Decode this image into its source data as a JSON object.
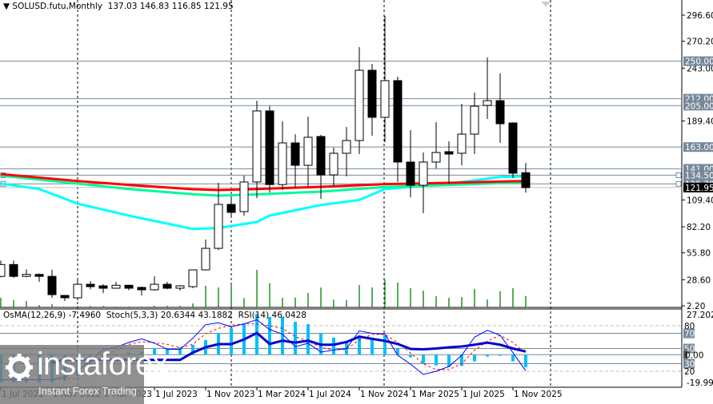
{
  "header": {
    "symbol": "SOLUSD.futu,Monthly",
    "ohlc": "137.03 146.83 116.85 121.95"
  },
  "indicator_header": {
    "osma": "OsMA(12,26,9) -7.4960",
    "stoch": "Stoch(5,3,3) 20.6344 43.1882",
    "rsi": "RSI(14) 46.0428"
  },
  "colors": {
    "level": "#778899",
    "volume": "#008000",
    "osma": "#00bfff",
    "ma_red": "#ff0000",
    "ma_green": "#00fa9a",
    "ma_cyan": "#00ffff",
    "stoch_main": "#0000ff",
    "stoch_signal": "#ff0000",
    "rsi": "#0000cd"
  },
  "price_axis": [
    "296.60",
    "270.20",
    "243.00",
    "189.40",
    "109.40",
    "82.20",
    "55.80",
    "28.60",
    "2.20"
  ],
  "levels": [
    "250.00",
    "212.00",
    "205.00",
    "163.00",
    "141.00",
    "134.50",
    "125.70"
  ],
  "current_price": "121.95",
  "indicator_axis": {
    "top": "27.2028",
    "bottom": "-19.9928",
    "levels": [
      "80",
      "70",
      "50",
      "30",
      "20"
    ],
    "zero": "0.00"
  },
  "time_axis": [
    "1 Jul 2022",
    "1 Nov 2022",
    "1 Mar 2023",
    "1 Jul 2023",
    "1 Nov 2023",
    "1 Mar 2024",
    "1 Jul 2024",
    "1 Nov 2024",
    "1 Mar 2025",
    "1 Jul 2025",
    "1 Nov 2025"
  ],
  "watermark": {
    "brand": "instaforex",
    "tagline": "Instant Forex Trading"
  },
  "candles": [
    [
      32,
      48,
      31,
      44
    ],
    [
      44,
      48,
      30.5,
      32
    ],
    [
      32,
      39,
      31,
      34
    ],
    [
      34,
      35,
      26.5,
      32
    ],
    [
      32,
      38.6,
      10.3,
      13.5
    ],
    [
      12.7,
      13,
      7,
      10.3
    ],
    [
      10.3,
      29.7,
      7.8,
      24
    ],
    [
      24,
      27.3,
      19,
      21.6
    ],
    [
      22.4,
      24,
      15,
      20
    ],
    [
      20,
      26.5,
      20,
      23
    ],
    [
      23,
      23.5,
      18,
      20
    ],
    [
      20.8,
      21.6,
      12.7,
      18.4
    ],
    [
      18.4,
      32.1,
      17.6,
      24
    ],
    [
      24,
      26.5,
      19,
      20
    ],
    [
      20,
      23.2,
      17.6,
      22.4
    ],
    [
      21.6,
      39,
      20,
      38.6
    ],
    [
      38.6,
      69.3,
      38,
      60.4
    ],
    [
      60.4,
      126.7,
      58.8,
      104.9
    ],
    [
      104.9,
      112,
      93,
      96.8
    ],
    [
      97.6,
      134,
      93.6,
      127.6
    ],
    [
      127.6,
      210,
      111.4,
      199.6
    ],
    [
      199.6,
      204.4,
      117,
      125
    ],
    [
      125,
      189,
      119.5,
      167.2
    ],
    [
      167.2,
      176,
      122,
      144.5
    ],
    [
      144.5,
      193.9,
      123.5,
      172.9
    ],
    [
      173.7,
      175.3,
      110.6,
      134.8
    ],
    [
      134.8,
      162.3,
      123.5,
      156.7
    ],
    [
      156.7,
      183.4,
      133.2,
      169.6
    ],
    [
      169.6,
      264.2,
      155.9,
      240.8
    ],
    [
      240.8,
      247.3,
      174.5,
      193.1
    ],
    [
      193.1,
      295.8,
      168,
      230.3
    ],
    [
      230.3,
      234.3,
      127.6,
      147.8
    ],
    [
      147.8,
      180.1,
      112.2,
      124.3
    ],
    [
      124.3,
      157.5,
      96,
      147.8
    ],
    [
      147.8,
      188.2,
      141.3,
      157.5
    ],
    [
      158.3,
      168.8,
      126,
      155.9
    ],
    [
      156.7,
      206.8,
      144.5,
      176.1
    ],
    [
      176.1,
      218.1,
      155.9,
      204.4
    ],
    [
      205.2,
      253.7,
      191.5,
      210
    ],
    [
      210,
      237.6,
      167.2,
      186.6
    ],
    [
      187.4,
      188,
      131.6,
      136.5
    ],
    [
      137.03,
      146.83,
      116.85,
      121.95
    ]
  ],
  "volume": [
    36,
    27,
    24,
    9,
    12,
    2,
    5,
    6,
    5,
    3,
    3,
    3,
    6,
    6,
    6,
    15,
    81,
    75,
    86,
    35,
    141,
    91,
    36,
    37,
    54,
    75,
    29,
    27,
    84,
    75,
    104,
    93,
    72,
    63,
    42,
    36,
    39,
    69,
    30,
    60,
    72,
    43
  ],
  "moving_averages": {
    "red": [
      [
        0,
        135.6
      ],
      [
        6,
        128.6
      ],
      [
        10,
        124.6
      ],
      [
        15,
        120.3
      ],
      [
        17,
        119.5
      ],
      [
        20,
        120.5
      ],
      [
        25,
        122.7
      ],
      [
        30,
        125.4
      ],
      [
        35,
        126.8
      ],
      [
        39,
        128.1
      ],
      [
        41,
        128.6
      ]
    ],
    "green": [
      [
        0,
        134
      ],
      [
        6,
        126
      ],
      [
        10,
        120.5
      ],
      [
        15,
        115.2
      ],
      [
        17,
        113.8
      ],
      [
        20,
        115
      ],
      [
        25,
        117.9
      ],
      [
        30,
        122.5
      ],
      [
        35,
        124.6
      ],
      [
        41,
        127.3
      ]
    ],
    "cyan": [
      [
        0,
        126
      ],
      [
        3,
        120.5
      ],
      [
        6,
        105.7
      ],
      [
        10,
        93.6
      ],
      [
        15,
        80
      ],
      [
        17,
        81
      ],
      [
        20,
        87.1
      ],
      [
        21,
        93.6
      ],
      [
        25,
        104.3
      ],
      [
        28,
        109.4
      ],
      [
        30,
        120.5
      ],
      [
        35,
        126
      ],
      [
        39,
        132.6
      ],
      [
        41,
        133.4
      ]
    ]
  },
  "osma": [
    -17,
    -17,
    -17,
    -17,
    -17,
    -16,
    -13,
    -8,
    -2.7,
    -0.8,
    1.3,
    2,
    3.9,
    3.6,
    4.5,
    6,
    8.9,
    13.1,
    16.2,
    18.8,
    24.9,
    23,
    23,
    20,
    18.6,
    12.9,
    10.4,
    7.8,
    11.7,
    9.7,
    11.7,
    3.6,
    -1.6,
    -5.2,
    -6.5,
    -7.4,
    -6.8,
    -4,
    -1.1,
    -0.6,
    -4,
    -7.5
  ],
  "stoch_main": [
    8.7,
    8.7,
    9,
    9,
    9,
    12.6,
    20,
    34,
    48.4,
    51.6,
    58,
    62.8,
    57,
    49,
    49,
    63.5,
    81.4,
    83.9,
    78.6,
    82.5,
    88,
    75,
    69,
    52.3,
    57,
    45.3,
    48,
    50,
    73.3,
    70,
    69,
    41,
    29.5,
    15.8,
    20,
    26.3,
    41,
    65,
    74,
    67.5,
    44.5,
    20.6
  ],
  "stoch_signal": [
    9,
    9,
    9,
    9,
    9,
    10,
    10,
    20.8,
    38.6,
    48.4,
    55.4,
    58.9,
    57.7,
    55.4,
    51.2,
    55.4,
    69.5,
    76.5,
    80.7,
    82.5,
    82.5,
    80,
    76.5,
    65.6,
    59.6,
    51.5,
    48,
    49,
    61.4,
    68.5,
    68.5,
    58,
    44,
    30,
    22.2,
    22.2,
    30,
    47.7,
    59.6,
    67.5,
    58,
    43.2
  ],
  "rsi": [
    null,
    null,
    null,
    null,
    31.6,
    35,
    35,
    35,
    35,
    35,
    35,
    35,
    35,
    35,
    35,
    44.6,
    51.6,
    55.8,
    55.8,
    62,
    70.5,
    56,
    60.3,
    57.8,
    60.3,
    55,
    55,
    58.6,
    65.6,
    62.8,
    60,
    56,
    49.5,
    48.9,
    50,
    51.6,
    52.7,
    55,
    57.7,
    55,
    50,
    46
  ]
}
